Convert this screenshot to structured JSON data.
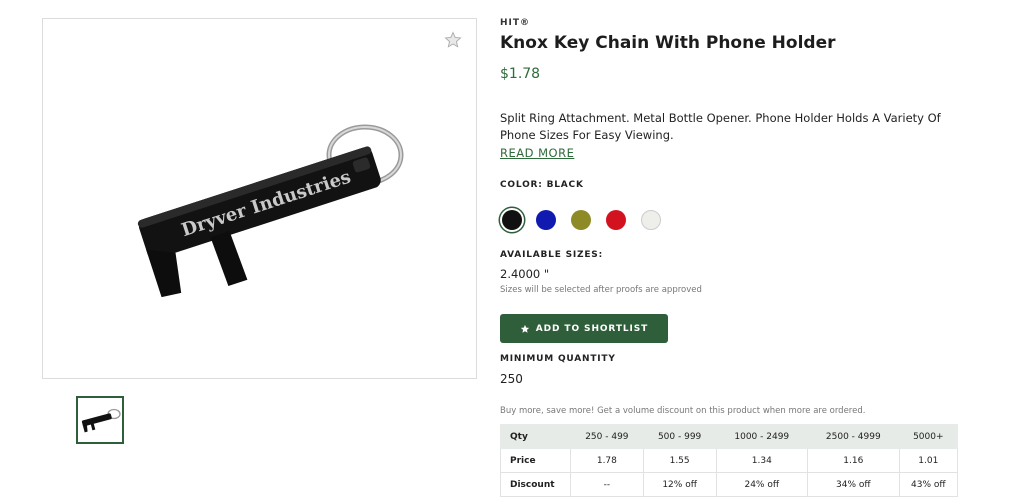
{
  "product": {
    "brand": "HIT®",
    "title": "Knox Key Chain With Phone Holder",
    "price": "$1.78",
    "description": "Split Ring Attachment. Metal Bottle Opener. Phone Holder Holds A Variety Of Phone Sizes For Easy Viewing.",
    "read_more": "READ MORE",
    "image_imprint": "Dryver Industries"
  },
  "icons": {
    "favorite": "star-outline-icon",
    "shortlist": "star-icon"
  },
  "color": {
    "label": "COLOR: BLACK",
    "selected": "black",
    "swatches": [
      {
        "name": "black",
        "hex": "#111111"
      },
      {
        "name": "blue",
        "hex": "#1019b0"
      },
      {
        "name": "olive",
        "hex": "#8e8a26"
      },
      {
        "name": "red",
        "hex": "#d31220"
      },
      {
        "name": "white",
        "hex": "#eeeeea"
      }
    ]
  },
  "sizes": {
    "label": "AVAILABLE SIZES:",
    "value": "2.4000 \"",
    "note": "Sizes will be selected after proofs are approved"
  },
  "shortlist_button": "ADD TO SHORTLIST",
  "minimum_quantity": {
    "label": "MINIMUM QUANTITY",
    "value": "250"
  },
  "volume_note": "Buy more, save more! Get a volume discount on this product when more are ordered.",
  "pricing_table": {
    "header": [
      "Qty",
      "250 - 499",
      "500 - 999",
      "1000 - 2499",
      "2500 - 4999",
      "5000+"
    ],
    "rows": [
      [
        "Price",
        "1.78",
        "1.55",
        "1.34",
        "1.16",
        "1.01"
      ],
      [
        "Discount",
        "--",
        "12% off",
        "24% off",
        "34% off",
        "43% off"
      ]
    ]
  },
  "theme": {
    "accent": "#2f5e3a",
    "price_color": "#2f6b3a",
    "table_header_bg": "#e6ebe7"
  }
}
